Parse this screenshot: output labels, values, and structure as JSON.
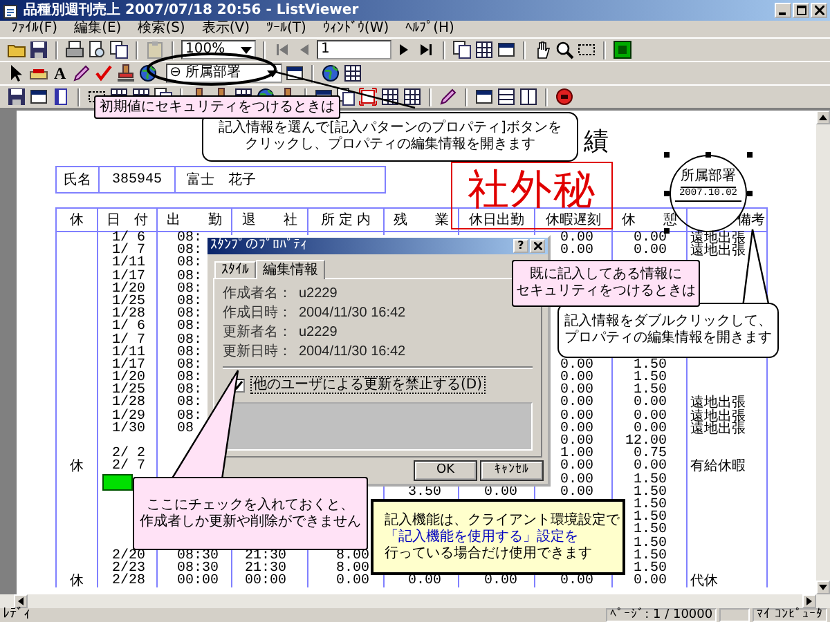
{
  "window": {
    "title": "品種別週刊売上 2007/07/18 20:56 - ListViewer"
  },
  "menu": [
    "ﾌｧｲﾙ(F)",
    "編集(E)",
    "検索(S)",
    "表示(V)",
    "ﾂｰﾙ(T)",
    "ｳｨﾝﾄﾞｳ(W)",
    "ﾍﾙﾌﾟ(H)"
  ],
  "toolbar": {
    "zoom": "100%",
    "page": "1",
    "text_tool": "A",
    "stamp_selector": "⊖ 所属部署"
  },
  "document": {
    "title": "績",
    "name_label": "氏名",
    "employee_id": "385945",
    "employee_name": "富士　花子",
    "columns": [
      "休",
      "日　付",
      "出　　勤",
      "退　　社",
      "所 定 内",
      "残　　業",
      "休日出勤",
      "休暇遅刻",
      "休　　憩",
      "備考"
    ],
    "rows": [
      {
        "date": "1/ 6",
        "in": "08:",
        "leave": "0.00",
        "break": "0.00",
        "note": "遠地出張",
        "stamped": false
      },
      {
        "date": "1/ 7",
        "in": "08:",
        "leave": "0.00",
        "break": "0.00",
        "note": "遠地出張",
        "stamped": false
      },
      {
        "date": "1/11",
        "in": "08:",
        "stamped": false
      },
      {
        "date": "1/17",
        "in": "08:",
        "stamped": false
      },
      {
        "date": "1/20",
        "in": "08:",
        "stamped": false
      },
      {
        "date": "1/25",
        "in": "08:",
        "stamped": false
      },
      {
        "date": "1/28",
        "in": "08:",
        "stamped": false
      },
      {
        "date": "1/ 6",
        "in": "08:",
        "stamped": false
      },
      {
        "date": "1/ 7",
        "in": "08:",
        "stamped": false
      },
      {
        "date": "1/11",
        "in": "08:",
        "stamped": false
      },
      {
        "date": "1/17",
        "in": "08:",
        "leave": "0.00",
        "break": "1.50",
        "stamped": false
      },
      {
        "date": "1/20",
        "in": "08:",
        "leave": "0.00",
        "break": "1.50",
        "stamped": false
      },
      {
        "date": "1/25",
        "in": "08:",
        "leave": "0.00",
        "break": "1.50",
        "stamped": false
      },
      {
        "date": "1/28",
        "in": "08:",
        "leave": "0.00",
        "break": "0.00",
        "note": "遠地出張",
        "stamped": false
      },
      {
        "date": "1/29",
        "in": "08:",
        "leave": "0.00",
        "break": "0.00",
        "note": "遠地出張",
        "stamped": false
      },
      {
        "date": "1/30",
        "in": "08",
        "leave": "0.00",
        "break": "0.00",
        "note": "遠地出張",
        "stamped": false
      },
      {
        "leave": "0.00",
        "break": "12.00",
        "stamped": false
      },
      {
        "date": "2/ 2",
        "leave": "1.00",
        "break": "0.75",
        "stamped": false
      },
      {
        "mark": "休",
        "date": "2/ 7",
        "leave": "0.00",
        "break": "0.00",
        "note": "有給休暇",
        "stamped": false
      },
      {
        "leave": "0.00",
        "break": "1.50",
        "stamped": true
      },
      {
        "overtime": "3.50",
        "holiday": "0.00",
        "leave": "0.00",
        "break": "1.50",
        "stamped": false
      },
      {
        "break": "1.50",
        "stamped": false
      },
      {
        "break": "1.50",
        "stamped": false
      },
      {
        "break": "1.50",
        "stamped": false
      },
      {
        "break": "1.50",
        "stamped": false
      },
      {
        "date": "2/20",
        "in": "08:30",
        "out": "21:30",
        "regular": "8.00",
        "break": "1.50",
        "stamped": false
      },
      {
        "date": "2/23",
        "in": "08:30",
        "out": "21:30",
        "regular": "8.00",
        "break": "1.50",
        "stamped": false
      },
      {
        "mark": "休",
        "date": "2/28",
        "in": "00:00",
        "out": "00:00",
        "regular": "0.00",
        "overtime": "0.00",
        "holiday": "0.00",
        "leave": "0.00",
        "break": "0.00",
        "note": "代休",
        "stamped": false
      }
    ]
  },
  "stamps": {
    "confidential": "社外秘",
    "department": {
      "top": "所属部署",
      "date": "2007.10.02",
      "selected": true
    }
  },
  "dialog": {
    "title": "ｽﾀﾝﾌﾟのﾌﾟﾛﾊﾟﾃｨ",
    "help": "?",
    "tabs": [
      {
        "label": "ｽﾀｲﾙ",
        "selected": false
      },
      {
        "label": "編集情報",
        "selected": true
      }
    ],
    "fields": [
      {
        "label": "作成者名：",
        "value": "u2229"
      },
      {
        "label": "作成日時：",
        "value": "2004/11/30 16:42"
      },
      {
        "label": "更新者名：",
        "value": "u2229"
      },
      {
        "label": "更新日時：",
        "value": "2004/11/30 16:42"
      }
    ],
    "lock": {
      "label": "他のユーザによる更新を禁止する(D)",
      "checked": true
    },
    "buttons": [
      "OK",
      "ｷｬﾝｾﾙ"
    ]
  },
  "callouts": [
    {
      "kind": "label",
      "lines": [
        {
          "text": "初期値にセキュリティをつけるときは",
          "highlighted": false
        }
      ]
    },
    {
      "kind": "bubble",
      "lines": [
        {
          "text": "記入情報を選んで[記入パターンのプロパティ]ボタンを",
          "highlighted": false
        },
        {
          "text": "クリックし、プロパティの編集情報を開きます",
          "highlighted": false
        }
      ]
    },
    {
      "kind": "label",
      "lines": [
        {
          "text": "既に記入してある情報に",
          "highlighted": false
        },
        {
          "text": "セキュリティをつけるときは",
          "highlighted": false
        }
      ]
    },
    {
      "kind": "bubble",
      "lines": [
        {
          "text": "記入情報をダブルクリックして、",
          "highlighted": false
        },
        {
          "text": "プロパティの編集情報を開きます",
          "highlighted": false
        }
      ]
    },
    {
      "kind": "label",
      "lines": [
        {
          "text": "ここにチェックを入れておくと、",
          "highlighted": false
        },
        {
          "text": "作成者しか更新や削除ができません",
          "highlighted": false
        }
      ]
    },
    {
      "kind": "note",
      "lines": [
        {
          "text": "記入機能は、クライアント環境設定で",
          "highlighted": false
        },
        {
          "text": "「記入機能を使用する」設定を",
          "highlighted": true
        },
        {
          "text": "行っている場合だけ使用できます",
          "highlighted": false
        }
      ]
    }
  ],
  "status_bar": {
    "state": "ﾚﾃﾞｨ",
    "page": "ﾍﾟｰｼﾞ: 1 / 10000",
    "computer": "ﾏｲ ｺﾝﾋﾟｭｰﾀ"
  }
}
